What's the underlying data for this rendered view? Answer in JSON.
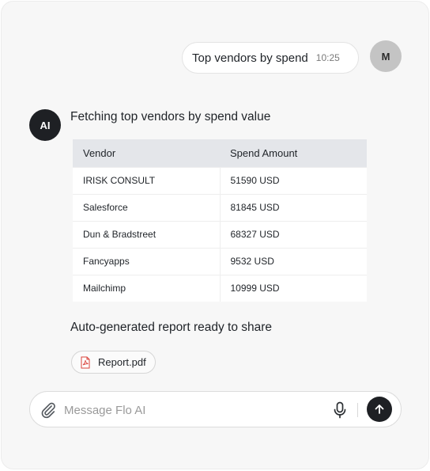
{
  "user_message": {
    "text": "Top vendors by spend",
    "time": "10:25",
    "avatar": "M"
  },
  "ai_message": {
    "avatar": "AI",
    "intro": "Fetching top vendors by spend value",
    "table": {
      "headers": [
        "Vendor",
        "Spend Amount"
      ],
      "rows": [
        [
          "IRISK CONSULT",
          "51590 USD"
        ],
        [
          "Salesforce",
          "81845 USD"
        ],
        [
          "Dun & Bradstreet",
          "68327 USD"
        ],
        [
          "Fancyapps",
          "9532 USD"
        ],
        [
          "Mailchimp",
          "10999 USD"
        ]
      ]
    },
    "report_text": "Auto-generated report ready to share",
    "attachment": {
      "name": "Report.pdf",
      "icon": "pdf-file-icon"
    }
  },
  "composer": {
    "placeholder": "Message Flo AI",
    "value": "",
    "icons": {
      "attach": "paperclip-icon",
      "mic": "microphone-icon",
      "send": "arrow-up-icon"
    }
  },
  "colors": {
    "panel_bg": "#f7f7f7",
    "dark": "#1e2024",
    "table_header": "#e4e6ea",
    "pdf_red": "#d9413a"
  }
}
